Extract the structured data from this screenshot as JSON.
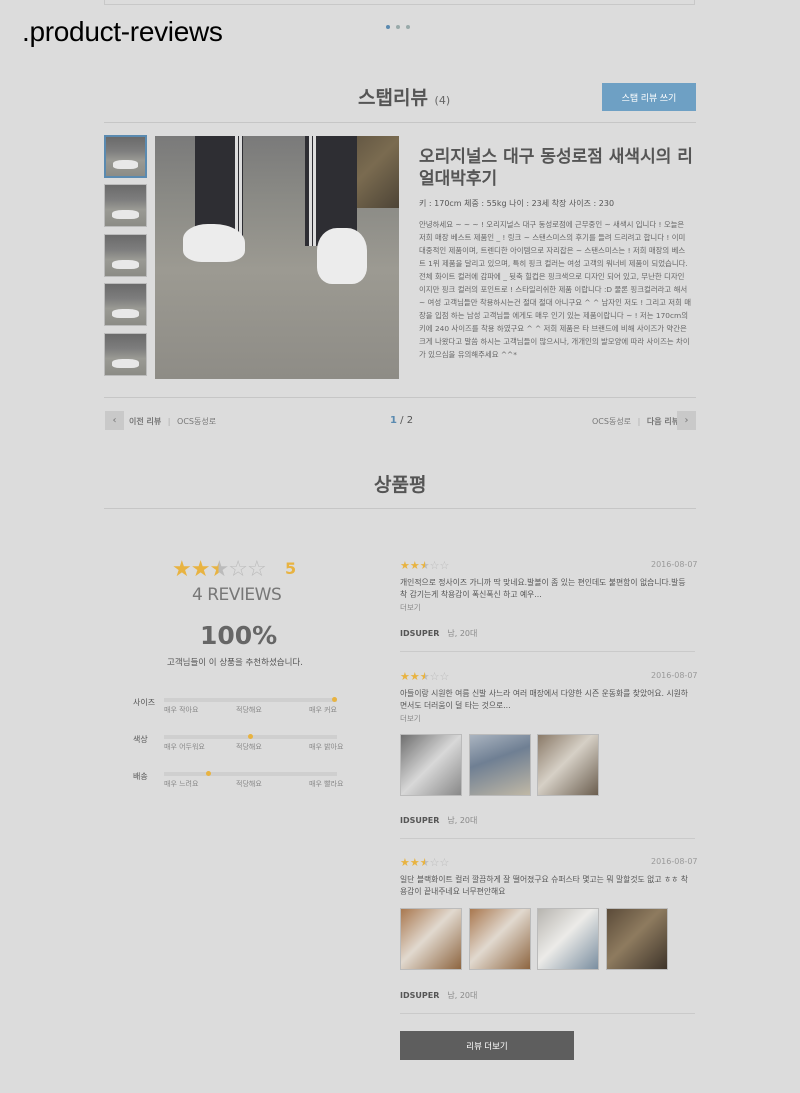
{
  "caption": ".product-reviews",
  "style_review": {
    "title": "스탭리뷰",
    "count": "(4)",
    "write_button": "스탭 리뷰 쓰기",
    "post": {
      "title": "오리지널스 대구 동성로점 새색시의 리얼대박후기",
      "meta": "키 : 170cm   체중 : 55kg   나이 : 23세   착장 사이즈 : 230",
      "body": "안녕하세요 ~ ~ ~ ! 오리지널스 대구 동성로점에 근무중인 ~ 새색시 입니다 ! 오늘은 저희 매장 베스트 제품인 _ ! 링크 ~ 스탠스미스의 후기를 들려 드리려고 합니다 ! 이미 대중적인 제품이며, 트렌디한 아이템으로 자리잡은 ~ 스탠스미스는 ! 저희 매장의 베스트 1위 제품을 달리고 있으며, 특히 핑크 컬러는 여성 고객의 워너비 제품이 되었습니다. 전체 화이트 컬러에 감파에 _ 뒷축 힐컵은 핑크색으로 디자인 되어 있고, 무난한 디자인이지만 핑크 컬러의 포인트로 ! 스타일리쉬한 제품 이랍니다 :D 물론 핑크컬러라고 해서 ~ 여성 고객님들만 착용하시는건 절대 절대 아니구요 ^ ^ 남자인 저도 ! 그리고 저희 매장을 입점 하는 남성 고객님들 에게도 매우 인기 있는 제품이랍니다 ~ ! 저는 170cm의 키에 240 사이즈를 착용 하였구요 ^ ^ 저희 제품은 타 브랜드에 비해 사이즈가 약간은 크게 나왔다고 말씀 하시는 고객님들이 많으시나, 개개인의 발모양에 따라 사이즈는 차이가 있으심을 유의해주세요 ^^*"
    },
    "pager": {
      "prev_label": "이전 리뷰",
      "prev_store": "OCS동성로",
      "current": "1",
      "total": "/ 2",
      "next_store": "OCS동성로",
      "next_label": "다음 리뷰"
    }
  },
  "product_review": {
    "title": "상품평",
    "summary": {
      "rating": 2.5,
      "score": "5",
      "reviews_count": "4 REVIEWS",
      "recommend_pct": "100%",
      "recommend_text": "고객님들이 이 상품을 추천하셨습니다.",
      "attributes": [
        {
          "label": "사이즈",
          "low": "매우 작아요",
          "mid": "적당해요",
          "high": "매우 커요",
          "value": 1.0
        },
        {
          "label": "색상",
          "low": "매우 어두워요",
          "mid": "적당해요",
          "high": "매우 밝아요",
          "value": 0.5
        },
        {
          "label": "배송",
          "low": "매우 느려요",
          "mid": "적당해요",
          "high": "매우 빨라요",
          "value": 0.25
        }
      ]
    },
    "reviews": [
      {
        "rating": 2.5,
        "date": "2016-08-07",
        "text": "개인적으로 정사이즈 가니까 딱 맞네요.발볼이 좀 있는 편인데도 불편함이 없습니다.발등 착 감기는게 착용감이 폭신폭신 하고 예우...",
        "more": "더보기",
        "user": "IDSUPER",
        "user_info": "남, 20대"
      },
      {
        "rating": 2.5,
        "date": "2016-08-07",
        "text": "아들이랑 시원한 여름 신발 사느라 여러 매장에서 다양한 시즌 운동화를 찾았어요. 시원하면서도 더러움이 덜 타는 것으로...",
        "more": "더보기",
        "user": "IDSUPER",
        "user_info": "남, 20대"
      },
      {
        "rating": 2.5,
        "date": "2016-08-07",
        "text": "일단 블랙화이트 컬러 깔끔하게 잘 떨어졌구요 슈퍼스타 몇고는 뭐 말할것도 없고 ㅎㅎ 착용감이 끝내주네요 너무편안해요",
        "more": "",
        "user": "IDSUPER",
        "user_info": "남, 20대"
      }
    ],
    "more_button": "리뷰 더보기"
  }
}
